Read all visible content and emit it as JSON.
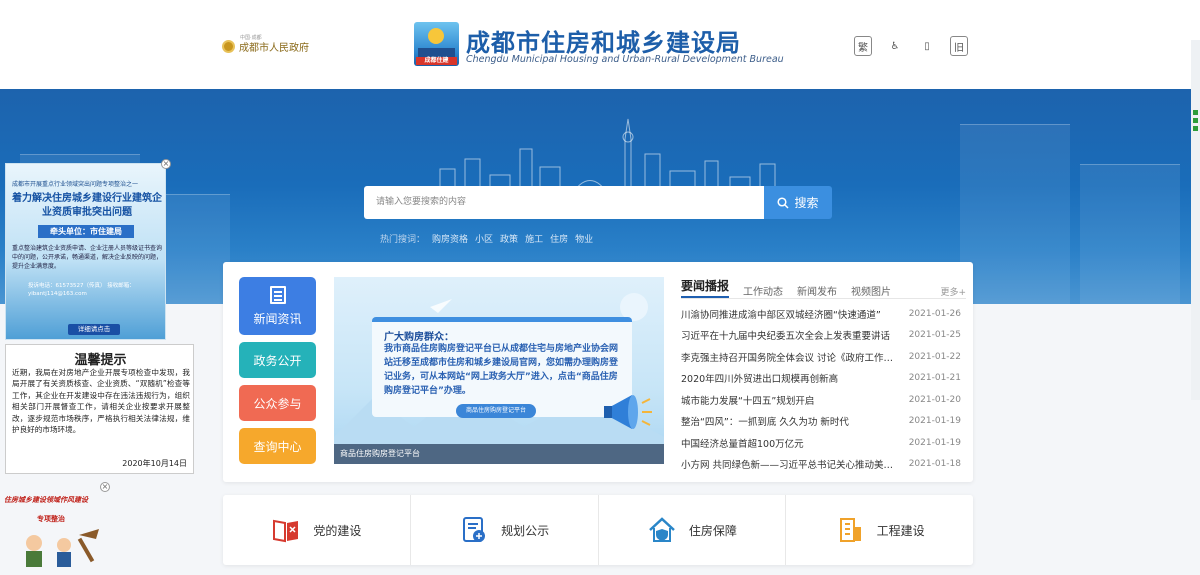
{
  "header": {
    "gov_logo_text": "成都市人民政府",
    "gov_logo_small": "中国·成都",
    "brand_title": "成都市住房和城乡建设局",
    "brand_subtitle": "Chengdu Municipal Housing and Urban-Rural Development Bureau",
    "brand_logo_tag": "成都住建",
    "tools": [
      "繁",
      "♿",
      "▯",
      "旧"
    ]
  },
  "search": {
    "placeholder": "请输入您要搜索的内容",
    "button_label": "搜索",
    "hot_label": "热门搜词：",
    "hot_words": [
      "购房资格",
      "小区",
      "政策",
      "施工",
      "住房",
      "物业"
    ]
  },
  "side_nav": {
    "items": [
      "新闻资讯",
      "政务公开",
      "公众参与",
      "查询中心"
    ]
  },
  "slide": {
    "heading": "广大购房群众：",
    "body": "我市商品住房购房登记平台已从成都住宅与房地产业协会网站迁移至成都市住房和城乡建设局官网，您如需办理购房登记业务，可从本网站“网上政务大厅”进入，点击“商品住房购房登记平台”办理。",
    "chip": "商品住房购房登记平台",
    "caption": "商品住房购房登记平台"
  },
  "news": {
    "tabs": [
      "要闻播报",
      "工作动态",
      "新闻发布",
      "视频图片"
    ],
    "more": "更多+",
    "items": [
      {
        "title": "川渝协同推进成渝中部区双城经济圈“快速通道”",
        "date": "2021-01-26"
      },
      {
        "title": "习近平在十九届中央纪委五次全会上发表重要讲话",
        "date": "2021-01-25"
      },
      {
        "title": "李克强主持召开国务院全体会议 讨论《政府工作报告》",
        "date": "2021-01-22"
      },
      {
        "title": "2020年四川外贸进出口规模再创新高",
        "date": "2021-01-21"
      },
      {
        "title": "城市能力发展“十四五”规划开启",
        "date": "2021-01-20"
      },
      {
        "title": "整治“四风”：一抓到底 久久为功 新时代",
        "date": "2021-01-19"
      },
      {
        "title": "中国经济总量首超100万亿元",
        "date": "2021-01-19"
      },
      {
        "title": "小方网 共同绿色新——习近平总书记关心推动美丽中国",
        "date": "2021-01-18"
      }
    ]
  },
  "services": [
    {
      "label": "党的建设",
      "icon": "party-book-icon",
      "color": "#d63a2f"
    },
    {
      "label": "规划公示",
      "icon": "plan-document-icon",
      "color": "#2a6fc7"
    },
    {
      "label": "住房保障",
      "icon": "house-shield-icon",
      "color": "#2a86c8"
    },
    {
      "label": "工程建设",
      "icon": "building-icon",
      "color": "#f0a22a"
    }
  ],
  "ad": {
    "line1": "成都市开展重点行业领域突出问题专项整治之一",
    "line2": "着力解决住房城乡建设行业建筑企业资质审批突出问题",
    "lead": "牵头单位：市住建局",
    "body": "重点整治建筑企业资质申请、企业注册人员等级证书查询中的问题，公开承诺，畅通渠道，解决企业反映的问题，提升企业满意度。",
    "contact": "投诉电话：61573527（传真）\n接收邮箱：yibantj114@163.com",
    "detail": "详细请点击"
  },
  "notice": {
    "title": "温馨提示",
    "body": "近期，我局在对房地产企业开展专项检查中发现，我局开展了有关资质核查、企业资质、“双随机”检查等工作，其企业在开发建设中存在违法违规行为，组织相关部门开展督查工作，请相关企业按要求开展整改，逐步规范市场秩序，严格执行相关法律法规，维护良好的市场环境。",
    "date": "2020年10月14日"
  },
  "promo": {
    "title": "住房城乡建设领域作风建设",
    "subtitle": "专项整治"
  },
  "colors": {
    "brand_blue": "#1d5ea9",
    "banner_blue": "#1a6dba",
    "search_button": "#3b8fe0",
    "side_news": "#3d7ee3",
    "side_gov": "#25b2b9",
    "side_public": "#f06a53",
    "side_query": "#f6a82c"
  }
}
